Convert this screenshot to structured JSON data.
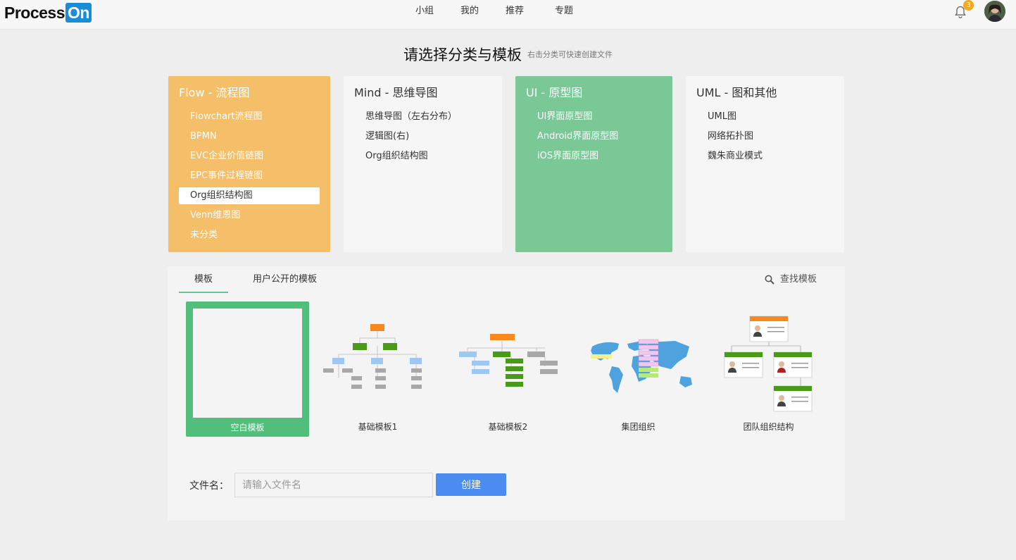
{
  "header": {
    "logo_text": "Process",
    "logo_badge": "On",
    "nav": [
      "小组",
      "我的",
      "推荐",
      "专题"
    ],
    "notification_count": "3"
  },
  "title": {
    "main": "请选择分类与模板",
    "hint": "右击分类可快速创建文件"
  },
  "categories": [
    {
      "title": "Flow - 流程图",
      "color": "#f5be68",
      "items": [
        "Flowchart流程图",
        "BPMN",
        "EVC企业价值链图",
        "EPC事件过程链图",
        "Org组织结构图",
        "Venn维恩图",
        "未分类"
      ],
      "selected_item": "Org组织结构图"
    },
    {
      "title": "Mind - 思维导图",
      "color": "#f6f6f6",
      "items": [
        "思维导图（左右分布）",
        "逻辑图(右)",
        "Org组织结构图"
      ]
    },
    {
      "title": "UI - 原型图",
      "color": "#79c896",
      "items": [
        "UI界面原型图",
        "Android界面原型图",
        "iOS界面原型图"
      ]
    },
    {
      "title": "UML - 图和其他",
      "color": "#f6f6f6",
      "items": [
        "UML图",
        "网络拓扑图",
        "魏朱商业模式"
      ]
    }
  ],
  "tabs": {
    "templates": "模板",
    "public_templates": "用户公开的模板",
    "search": "查找模板"
  },
  "templates": [
    {
      "label": "空白模板",
      "selected": true
    },
    {
      "label": "基础模板1"
    },
    {
      "label": "基础模板2"
    },
    {
      "label": "集团组织"
    },
    {
      "label": "团队组织结构"
    }
  ],
  "filename": {
    "label": "文件名：",
    "placeholder": "请输入文件名",
    "value": ""
  },
  "create_button": "创建",
  "colors": {
    "accent_green": "#52be7b",
    "button_blue": "#4a8cf0",
    "badge_orange": "#f5a623"
  }
}
